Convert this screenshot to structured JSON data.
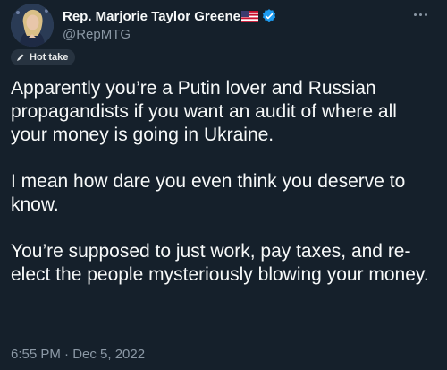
{
  "author": {
    "display_name": "Rep. Marjorie Taylor Greene",
    "handle": "@RepMTG"
  },
  "label": {
    "text": "Hot take"
  },
  "tweet": {
    "paragraphs": [
      "Apparently you’re a Putin lover and Russian propagandists if you want an audit of where all your money is going in Ukraine.",
      "I mean how dare you even think you deserve to know.",
      "You’re supposed to just work, pay taxes, and re-elect the people mysteriously blowing your money."
    ],
    "timestamp": "6:55 PM · Dec 5, 2022"
  },
  "colors": {
    "background": "#15202b",
    "text": "#f7f9f9",
    "secondary": "#8b98a5",
    "verified": "#1d9bf0"
  },
  "icons": {
    "more": "more-horizontal-icon",
    "verified": "verified-badge-icon",
    "flag": "us-flag-icon",
    "label": "pen-icon"
  }
}
